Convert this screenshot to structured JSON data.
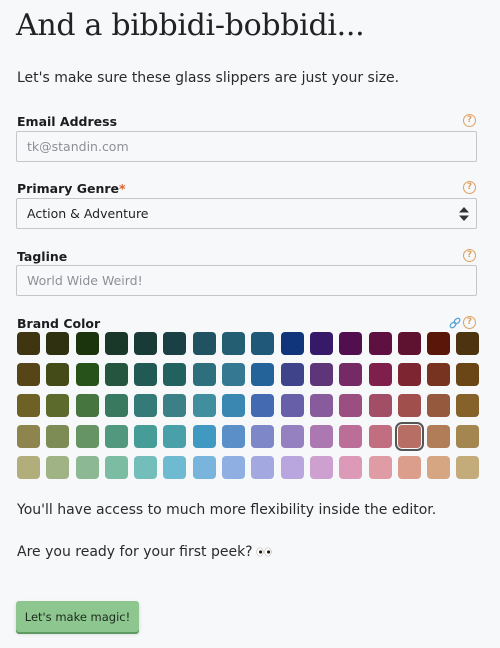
{
  "header": {
    "title": "And a bibbidi-bobbidi...",
    "subtitle": "Let's make sure these glass slippers are just your size."
  },
  "form": {
    "email": {
      "label": "Email Address",
      "placeholder": "tk@standin.com",
      "value": "",
      "help_icon": "question-circle-icon"
    },
    "genre": {
      "label": "Primary Genre",
      "required_marker": "*",
      "selected": "Action & Adventure",
      "help_icon": "question-circle-icon"
    },
    "tagline": {
      "label": "Tagline",
      "placeholder": "World Wide Weird!",
      "value": "",
      "help_icon": "question-circle-icon"
    },
    "brand_color": {
      "label": "Brand Color",
      "link_icon": "link-icon",
      "help_icon": "question-circle-icon",
      "selected": {
        "row": 3,
        "col": 13
      },
      "swatches": [
        [
          "#3f3510",
          "#2f300f",
          "#1c340e",
          "#19382a",
          "#183b38",
          "#1a3f45",
          "#205261",
          "#245e72",
          "#1f5878",
          "#10357a",
          "#37196a",
          "#520f50",
          "#5e1141",
          "#5e1230",
          "#5a1609",
          "#4d330f"
        ],
        [
          "#564516",
          "#444b18",
          "#275219",
          "#25553f",
          "#215a55",
          "#23615f",
          "#2d6f7c",
          "#357892",
          "#24639a",
          "#3f438a",
          "#5e3578",
          "#752a66",
          "#7f1f4c",
          "#7d2530",
          "#773320",
          "#6a4616"
        ],
        [
          "#6e6126",
          "#5c6a2c",
          "#467540",
          "#387960",
          "#347a78",
          "#3a8086",
          "#418e9e",
          "#3a87b1",
          "#446ab1",
          "#6760a8",
          "#885b9c",
          "#9b4e80",
          "#a24e66",
          "#a04f4c",
          "#955a3d",
          "#846229"
        ],
        [
          "#8d844e",
          "#7d8c55",
          "#669465",
          "#51987e",
          "#469c97",
          "#4aa0a9",
          "#4099c0",
          "#5b8fc8",
          "#7e87c8",
          "#9681c0",
          "#ab78b2",
          "#bb6f98",
          "#c06e80",
          "#b76f65",
          "#b07d58",
          "#a48650"
        ],
        [
          "#b2ae7c",
          "#a0b385",
          "#8cb993",
          "#7bbca3",
          "#73beba",
          "#6ebad0",
          "#79b4dc",
          "#8faee2",
          "#a4a8e0",
          "#b9a6de",
          "#cda0cf",
          "#dc9ab8",
          "#e09ca4",
          "#dc9e8c",
          "#d6a582",
          "#c4ac7a"
        ]
      ]
    }
  },
  "footer": {
    "flex_note": "You'll have access to much more flexibility inside the editor.",
    "peek_question": "Are you ready for your first peek?",
    "peek_emoji": "eyes-icon",
    "cta_label": "Let's make magic!"
  },
  "colors": {
    "accent_orange": "#e0a060",
    "link_blue": "#5aa6d6",
    "cta_green": "#8dc78f",
    "required_red": "#d9622b"
  }
}
